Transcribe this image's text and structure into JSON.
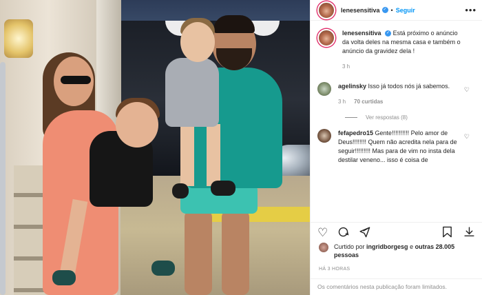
{
  "post": {
    "username": "lenesensitiva",
    "follow_label": "Seguir",
    "separator": "•",
    "more_label": "•••"
  },
  "caption": {
    "username": "lenesensitiva",
    "text": "Está próximo o anúncio da volta deles na mesma casa e também o anúncio da gravidez dela !",
    "time": "3 h"
  },
  "comments": [
    {
      "username": "agelinsky",
      "text": "Isso já todos nós já sabemos.",
      "time": "3 h",
      "likes": "70 curtidas",
      "replies": "Ver respostas (8)"
    },
    {
      "username": "fefapedro15",
      "text": "Gente!!!!!!!!!! Pelo amor de Deus!!!!!!!! Quem não acredita nela para de seguir!!!!!!!!! Mas para de vim no insta dela destilar veneno... isso é coisa de"
    }
  ],
  "likes": {
    "prefix": "Curtido por",
    "user": "ingridborgesg",
    "middle": "e",
    "count": "outras 28.005 pessoas"
  },
  "time_ago": "HÁ 3 HORAS",
  "comments_limited": "Os comentários nesta publicação foram limitados.",
  "colors": {
    "follow": "#0095f6",
    "verified": "#3897f0",
    "muted": "#8e8e8e",
    "story_ring": "#e1306c"
  }
}
